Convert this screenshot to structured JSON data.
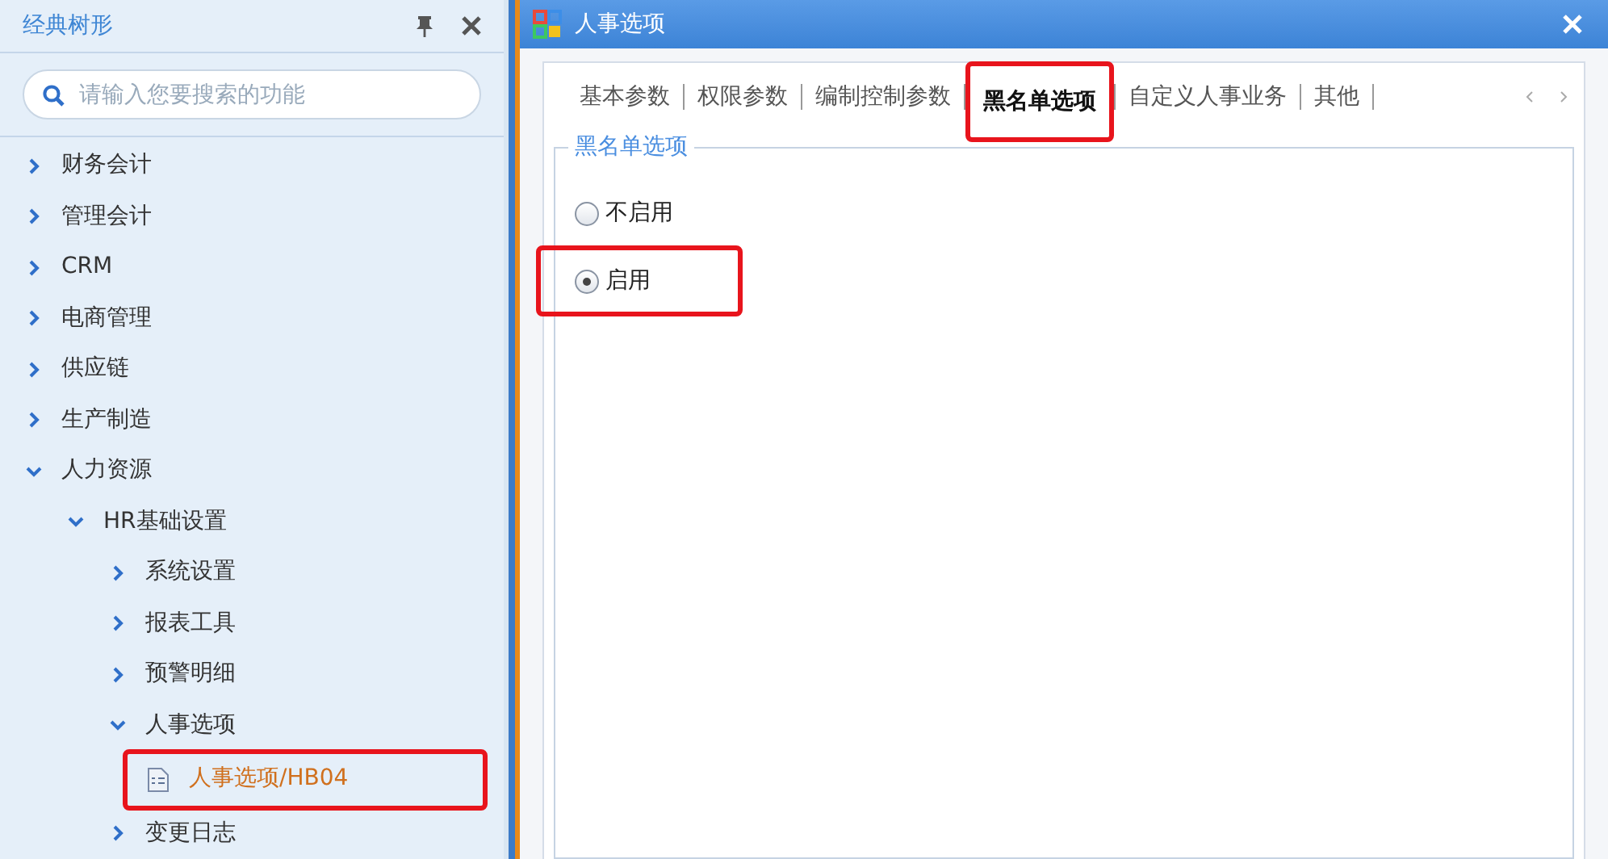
{
  "sidebar": {
    "title": "经典树形",
    "search": {
      "placeholder": "请输入您要搜索的功能"
    },
    "tree": [
      {
        "label": "财务会计",
        "expanded": false,
        "selected": false,
        "highlighted": false
      },
      {
        "label": "管理会计",
        "expanded": false,
        "selected": false,
        "highlighted": false
      },
      {
        "label": "CRM",
        "expanded": false,
        "selected": false,
        "highlighted": false
      },
      {
        "label": "电商管理",
        "expanded": false,
        "selected": false,
        "highlighted": false
      },
      {
        "label": "供应链",
        "expanded": false,
        "selected": false,
        "highlighted": false
      },
      {
        "label": "生产制造",
        "expanded": false,
        "selected": false,
        "highlighted": false
      },
      {
        "label": "人力资源",
        "expanded": true,
        "selected": false,
        "highlighted": false,
        "children": [
          {
            "label": "HR基础设置",
            "expanded": true,
            "selected": false,
            "highlighted": false,
            "children": [
              {
                "label": "系统设置",
                "expanded": false,
                "selected": false,
                "highlighted": false
              },
              {
                "label": "报表工具",
                "expanded": false,
                "selected": false,
                "highlighted": false
              },
              {
                "label": "预警明细",
                "expanded": false,
                "selected": false,
                "highlighted": false
              },
              {
                "label": "人事选项",
                "expanded": true,
                "selected": false,
                "highlighted": false,
                "children": [
                  {
                    "kind": "leaf",
                    "label": "人事选项/HB04",
                    "selected": true,
                    "highlighted": true
                  }
                ]
              },
              {
                "label": "变更日志",
                "expanded": false,
                "selected": false,
                "highlighted": false
              }
            ]
          }
        ]
      }
    ]
  },
  "dialog": {
    "title": "人事选项",
    "tabs": [
      {
        "label": "基本参数",
        "selected": false,
        "highlighted": false
      },
      {
        "label": "权限参数",
        "selected": false,
        "highlighted": false
      },
      {
        "label": "编制控制参数",
        "selected": false,
        "highlighted": false
      },
      {
        "label": "黑名单选项",
        "selected": true,
        "highlighted": true
      },
      {
        "label": "自定义人事业务",
        "selected": false,
        "highlighted": false
      },
      {
        "label": "其他",
        "selected": false,
        "highlighted": false
      }
    ],
    "group": {
      "title": "黑名单选项",
      "options": [
        {
          "label": "不启用",
          "selected": false,
          "highlighted": false
        },
        {
          "label": "启用",
          "selected": true,
          "highlighted": true
        }
      ]
    }
  }
}
